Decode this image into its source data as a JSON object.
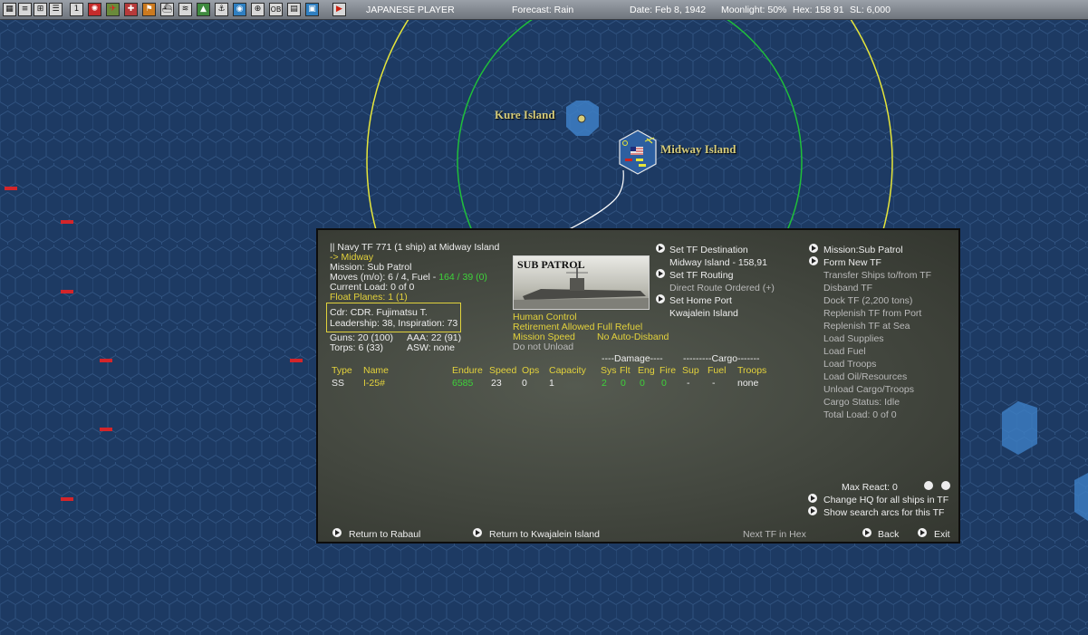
{
  "toolbar": {
    "player": "JAPANESE PLAYER",
    "forecast": "Forecast: Rain",
    "date": "Date: Feb 8, 1942",
    "moonlight": "Moonlight: 50%",
    "hex": "Hex: 158 91",
    "sl": "SL: 6,000"
  },
  "map": {
    "kure_label": "Kure Island",
    "midway_label": "Midway Island"
  },
  "tf": {
    "header": "|| Navy TF 771 (1 ship) at Midway Island",
    "destination": "-> Midway",
    "mission": "Mission: Sub Patrol",
    "moves_prefix": "Moves (m/o): 6 / 4, Fuel -",
    "fuel_value": "164 / 39 (0)",
    "current_load": "Current Load: 0 of 0",
    "float_planes": "Float Planes: 1 (1)",
    "commander": "Cdr: CDR. Fujimatsu T.",
    "leadership": "Leadership: 38, Inspiration: 73",
    "guns": "Guns: 20 (100)",
    "aaa": "AAA: 22 (91)",
    "torps": "Torps: 6 (33)",
    "asw": "ASW: none"
  },
  "photo": {
    "title": "SUB PATROL"
  },
  "status": {
    "human_control": "Human Control",
    "retirement": "Retirement Allowed",
    "full_refuel": "Full Refuel",
    "mission_speed": "Mission Speed",
    "no_auto_disband": "No Auto-Disband",
    "do_not_unload": "Do not Unload"
  },
  "orders": {
    "set_destination": "Set TF Destination",
    "destination_value": "Midway Island - 158,91",
    "set_routing": "Set TF Routing",
    "direct_route": "Direct Route Ordered (+)",
    "set_home_port": "Set Home Port",
    "home_port_value": "Kwajalein Island"
  },
  "actions": {
    "mission": "Mission:Sub Patrol",
    "form_new": "Form New TF",
    "transfer": "Transfer Ships to/from TF",
    "disband": "Disband TF",
    "dock": "Dock TF (2,200 tons)",
    "replenish_port": "Replenish TF from Port",
    "replenish_sea": "Replenish TF at Sea",
    "load_supplies": "Load Supplies",
    "load_fuel": "Load Fuel",
    "load_troops": "Load Troops",
    "load_oil": "Load Oil/Resources",
    "unload": "Unload Cargo/Troops",
    "cargo_status": "Cargo Status: Idle",
    "total_load": "Total Load: 0 of 0"
  },
  "table": {
    "damage_group": "----Damage----",
    "cargo_group": "---------Cargo-------",
    "headers": {
      "type": "Type",
      "name": "Name",
      "endure": "Endure",
      "speed": "Speed",
      "ops": "Ops",
      "capacity": "Capacity",
      "sys": "Sys",
      "flt": "Flt",
      "eng": "Eng",
      "fire": "Fire",
      "sup": "Sup",
      "fuel": "Fuel",
      "troops": "Troops"
    },
    "rows": [
      {
        "type": "SS",
        "name": "I-25#",
        "endure": "6585",
        "speed": "23",
        "ops": "0",
        "capacity": "1",
        "sys": "2",
        "flt": "0",
        "eng": "0",
        "fire": "0",
        "sup": "-",
        "fuel": "-",
        "troops": "none"
      }
    ]
  },
  "lower_right": {
    "max_react": "Max React: 0",
    "change_hq": "Change HQ for all ships in TF",
    "show_arcs": "Show search arcs for this TF"
  },
  "footer": {
    "return_rabaul": "Return to Rabaul",
    "return_kwajalein": "Return to Kwajalein Island",
    "next_tf": "Next TF in Hex",
    "back": "Back",
    "exit": "Exit"
  },
  "colors": {
    "sea": "#1d3a63",
    "hex_line": "#2f5180",
    "accent_yellow": "#e3d23c",
    "accent_green": "#3ed33a",
    "range_yellow": "#e6e63a",
    "range_green": "#1fbf3a"
  }
}
